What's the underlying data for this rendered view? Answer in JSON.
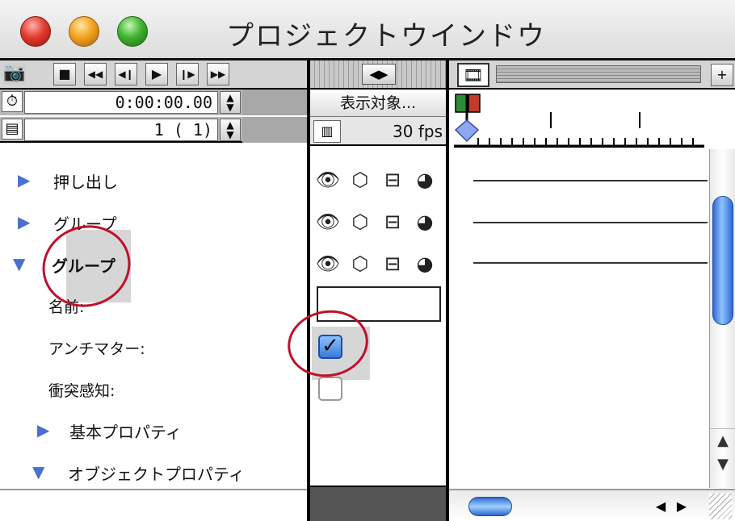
{
  "window": {
    "title": "プロジェクトウインドウ"
  },
  "transport": {
    "camera_icon": "camera-icon",
    "buttons": [
      "■",
      "◀◀",
      "◀❙",
      "▶",
      "❙▶",
      "▶▶"
    ]
  },
  "time": {
    "icon": "clock-icon",
    "value": "0:00:00.00"
  },
  "frame": {
    "icon": "frame-icon",
    "value": "1 ( 1)"
  },
  "tree": {
    "items": [
      {
        "label": "押し出し",
        "expanded": false
      },
      {
        "label": "グループ",
        "expanded": false
      },
      {
        "label": "グループ",
        "expanded": true
      }
    ],
    "properties": [
      {
        "label": "名前:"
      },
      {
        "label": "アンチマター:"
      },
      {
        "label": "衝突感知:"
      }
    ],
    "sections": [
      {
        "label": "基本プロパティ",
        "expanded": false
      },
      {
        "label": "オブジェクトプロパティ",
        "expanded": true
      }
    ]
  },
  "middle": {
    "display_button": "表示対象...",
    "fps": "30 fps",
    "layer_icons": [
      "eye-icon",
      "cube-icon",
      "layers-icon",
      "texture-icon"
    ],
    "name_value": "",
    "antimatter_checked": true,
    "collision_checked": false
  },
  "timeline": {
    "film_icon": "film-icon",
    "plus_label": "+"
  },
  "colors": {
    "annotation": "#c0102a",
    "accent_blue": "#3a79d8",
    "triangle": "#4a6fd0"
  }
}
